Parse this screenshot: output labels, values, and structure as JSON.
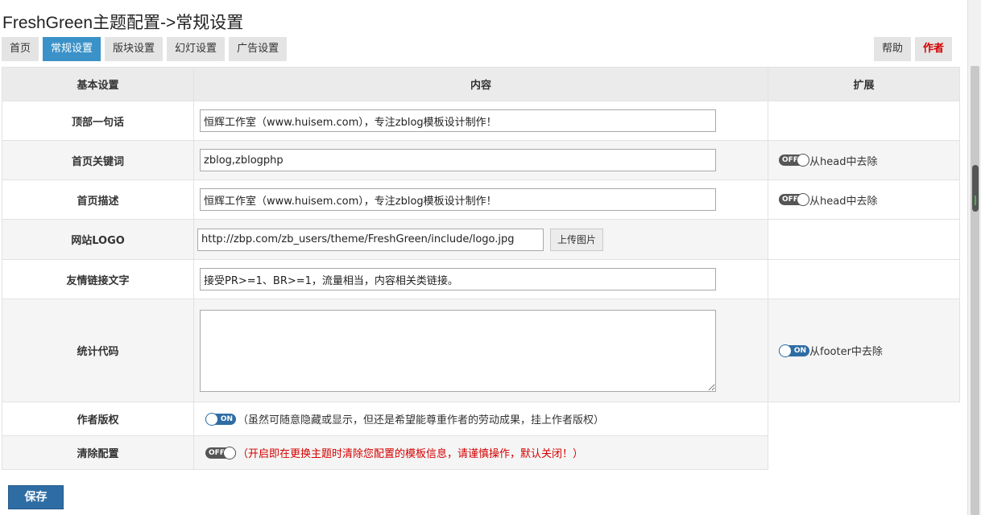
{
  "header": {
    "title": "FreshGreen主题配置->常规设置"
  },
  "tabs": [
    {
      "label": "首页",
      "active": false
    },
    {
      "label": "常规设置",
      "active": true
    },
    {
      "label": "版块设置",
      "active": false
    },
    {
      "label": "幻灯设置",
      "active": false
    },
    {
      "label": "广告设置",
      "active": false
    }
  ],
  "right_tabs": {
    "help": "帮助",
    "author": "作者"
  },
  "table": {
    "headers": {
      "setting": "基本设置",
      "content": "内容",
      "extension": "扩展"
    },
    "rows": {
      "top_sentence": {
        "label": "顶部一句话",
        "value": "恒辉工作室（www.huisem.com），专注zblog模板设计制作！"
      },
      "keywords": {
        "label": "首页关键词",
        "value": "zblog,zblogphp",
        "toggle": "OFF",
        "ext": "从head中去除"
      },
      "description": {
        "label": "首页描述",
        "value": "恒辉工作室（www.huisem.com），专注zblog模板设计制作！",
        "toggle": "OFF",
        "ext": "从head中去除"
      },
      "logo": {
        "label": "网站LOGO",
        "value": "http://zbp.com/zb_users/theme/FreshGreen/include/logo.jpg",
        "button": "上传图片"
      },
      "friend_link": {
        "label": "友情链接文字",
        "value": "接受PR>=1、BR>=1，流量相当，内容相关类链接。"
      },
      "stats": {
        "label": "统计代码",
        "value": "",
        "toggle": "ON",
        "ext": "从footer中去除"
      },
      "copyright": {
        "label": "作者版权",
        "toggle": "ON",
        "note": "（虽然可随意隐藏或显示，但还是希望能尊重作者的劳动成果，挂上作者版权）"
      },
      "clear": {
        "label": "清除配置",
        "toggle": "OFF",
        "note": "（开启即在更换主题时清除您配置的模板信息，请谨慎操作，默认关闭！）"
      }
    }
  },
  "save_label": "保存",
  "colors": {
    "accent": "#3a92c8",
    "button": "#2e6da4",
    "warning": "#d40000"
  }
}
